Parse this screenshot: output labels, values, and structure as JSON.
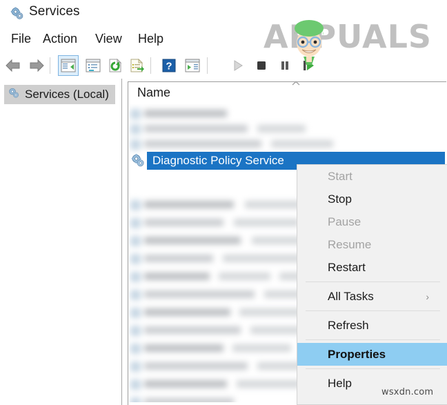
{
  "window": {
    "title": "Services",
    "title_icon": "services-gear-icon"
  },
  "menubar": {
    "items": [
      {
        "label": "File",
        "name": "menu-file"
      },
      {
        "label": "Action",
        "name": "menu-action"
      },
      {
        "label": "View",
        "name": "menu-view"
      },
      {
        "label": "Help",
        "name": "menu-help"
      }
    ]
  },
  "toolbar": {
    "buttons": [
      {
        "name": "back-icon",
        "title": "Back"
      },
      {
        "name": "forward-icon",
        "title": "Forward"
      },
      {
        "name": "show-console-tree-icon",
        "title": "Show/Hide Console Tree",
        "selected": true
      },
      {
        "name": "properties-icon",
        "title": "Properties"
      },
      {
        "name": "refresh-icon",
        "title": "Refresh"
      },
      {
        "name": "export-list-icon",
        "title": "Export List"
      },
      {
        "name": "help-icon",
        "title": "Help"
      },
      {
        "name": "show-action-pane-icon",
        "title": "Show/Hide Action Pane"
      },
      {
        "name": "start-service-icon",
        "title": "Start Service",
        "disabled": true
      },
      {
        "name": "stop-service-icon",
        "title": "Stop Service"
      },
      {
        "name": "pause-service-icon",
        "title": "Pause Service"
      },
      {
        "name": "restart-service-icon",
        "title": "Restart Service"
      }
    ]
  },
  "tree": {
    "root_label": "Services (Local)"
  },
  "list": {
    "column_header": "Name",
    "sort_indicator": "ascending",
    "selected_row": {
      "label": "Diagnostic Policy Service",
      "icon": "service-gear-icon"
    },
    "blurred_rows_above": 3,
    "blurred_rows_below": 11
  },
  "context_menu": {
    "items": [
      {
        "label": "Start",
        "name": "ctx-start",
        "state": "disabled"
      },
      {
        "label": "Stop",
        "name": "ctx-stop",
        "state": "enabled"
      },
      {
        "label": "Pause",
        "name": "ctx-pause",
        "state": "disabled"
      },
      {
        "label": "Resume",
        "name": "ctx-resume",
        "state": "disabled"
      },
      {
        "label": "Restart",
        "name": "ctx-restart",
        "state": "enabled"
      },
      {
        "label": "All Tasks",
        "name": "ctx-all-tasks",
        "state": "enabled",
        "submenu": true,
        "arrow": "›"
      },
      {
        "label": "Refresh",
        "name": "ctx-refresh",
        "state": "enabled"
      },
      {
        "label": "Properties",
        "name": "ctx-properties",
        "state": "highlighted"
      },
      {
        "label": "Help",
        "name": "ctx-help",
        "state": "enabled"
      }
    ]
  },
  "watermarks": {
    "brand": "APPUALS",
    "site": "wsxdn.com"
  },
  "colors": {
    "selection_blue": "#1b74c4",
    "menu_highlight": "#8ecdf2",
    "toolbar_selected": "#ddeefb",
    "tree_selection": "#cfcfcf"
  }
}
